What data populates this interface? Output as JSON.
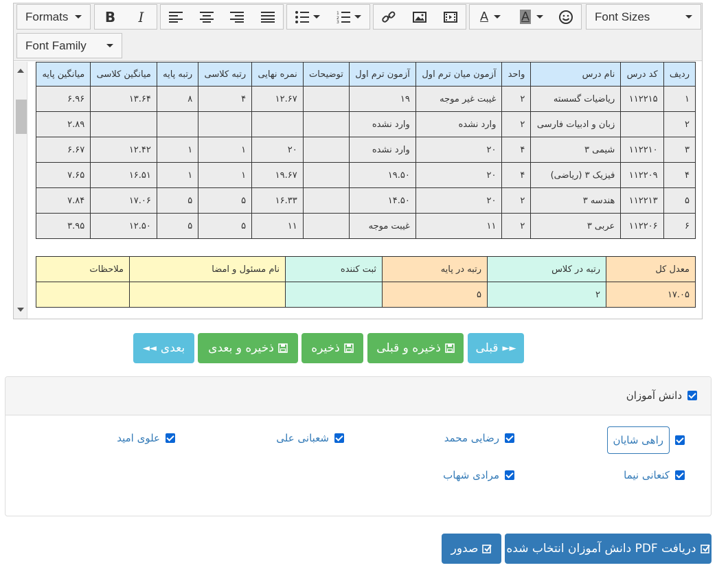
{
  "toolbar": {
    "formats_label": "Formats",
    "font_sizes_label": "Font Sizes",
    "font_family_label": "Font Family"
  },
  "grades_table": {
    "headers": [
      "ردیف",
      "کد درس",
      "نام درس",
      "واحد",
      "آزمون میان ترم اول",
      "آزمون ترم اول",
      "توضیحات",
      "نمره نهایی",
      "رتبه کلاسی",
      "رتبه پایه",
      "میانگین کلاسی",
      "میانگین پایه"
    ],
    "rows": [
      [
        "۱",
        "۱۱۲۲۱۵",
        "ریاضیات گسسته",
        "۲",
        "غیبت غیر موجه",
        "۱۹",
        "",
        "۱۲.۶۷",
        "۴",
        "۸",
        "۱۳.۶۴",
        "۶.۹۶"
      ],
      [
        "۲",
        "",
        "زبان و ادبیات فارسی",
        "۲",
        "وارد نشده",
        "وارد نشده",
        "",
        "",
        "",
        "",
        "",
        "۲.۸۹"
      ],
      [
        "۳",
        "۱۱۲۲۱۰",
        "شیمی ۳",
        "۴",
        "۲۰",
        "وارد نشده",
        "",
        "۲۰",
        "۱",
        "۱",
        "۱۲.۴۲",
        "۶.۶۷"
      ],
      [
        "۴",
        "۱۱۲۲۰۹",
        "فیزیک ۳ (ریاضی)",
        "۴",
        "۲۰",
        "۱۹.۵۰",
        "",
        "۱۹.۶۷",
        "۱",
        "۱",
        "۱۶.۵۱",
        "۷.۶۵"
      ],
      [
        "۵",
        "۱۱۲۲۱۳",
        "هندسه ۳",
        "۲",
        "۲۰",
        "۱۴.۵۰",
        "",
        "۱۶.۳۳",
        "۵",
        "۵",
        "۱۷.۰۶",
        "۷.۸۴"
      ],
      [
        "۶",
        "۱۱۲۲۰۶",
        "عربی ۳",
        "۲",
        "۱۱",
        "غیبت موجه",
        "",
        "۱۱",
        "۵",
        "۵",
        "۱۲.۵۰",
        "۳.۹۵"
      ]
    ]
  },
  "summary_table": {
    "headers": [
      "معدل کل",
      "رتبه در کلاس",
      "رتبه در پایه",
      "ثبت کننده",
      "نام مسئول و امضا",
      "ملاحظات"
    ],
    "values": [
      "۱۷.۰۵",
      "۲",
      "۵",
      "",
      "",
      ""
    ]
  },
  "nav_buttons": {
    "prev": "قبلی",
    "save_prev": "ذخیره و قبلی",
    "save": "ذخیره",
    "save_next": "ذخیره و بعدی",
    "next": "بعدی"
  },
  "students_panel": {
    "title": "دانش آموزان",
    "students": [
      "راهی شایان",
      "رضایی محمد",
      "شعبانی علی",
      "علوی امید",
      "کنعانی نیما",
      "مرادی شهاب"
    ]
  },
  "actions": {
    "download_pdf": "دریافت PDF دانش آموزان انتخاب شده",
    "issue": "صدور"
  },
  "colors": {
    "header_blue": "#cfe8fb",
    "info": "#5bc0de",
    "success": "#5cb85c",
    "primary": "#337ab7"
  }
}
